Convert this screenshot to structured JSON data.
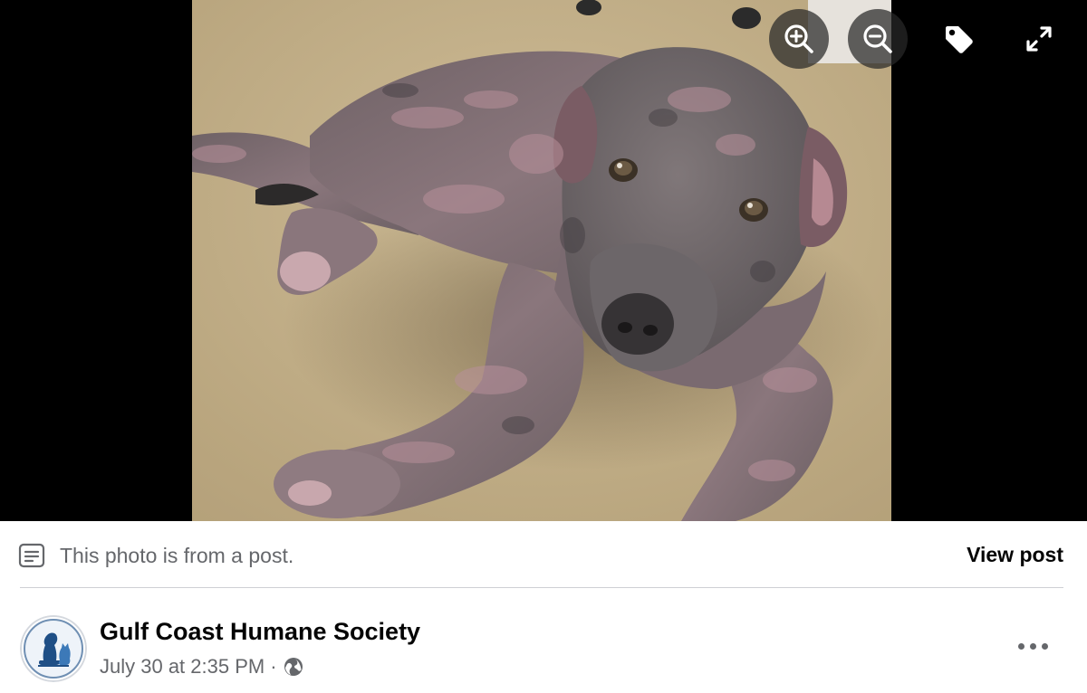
{
  "viewer": {
    "controls": {
      "zoom_in": "zoom-in-icon",
      "zoom_out": "zoom-out-icon",
      "tag": "tag-icon",
      "fullscreen": "fullscreen-expand-icon"
    },
    "colors": {
      "background": "#000000",
      "control_bg": "#333333",
      "icon": "#ffffff"
    }
  },
  "banner": {
    "icon": "post-note-icon",
    "text": "This photo is from a post.",
    "view_post_label": "View post"
  },
  "post": {
    "author": "Gulf Coast Humane Society",
    "timestamp": "July 30 at 2:35 PM",
    "separator": "·",
    "audience_icon": "globe-icon",
    "more_icon": "more-options-icon"
  },
  "colors": {
    "primary_text": "#050505",
    "secondary_text": "#65676b",
    "divider": "#ced0d4"
  }
}
